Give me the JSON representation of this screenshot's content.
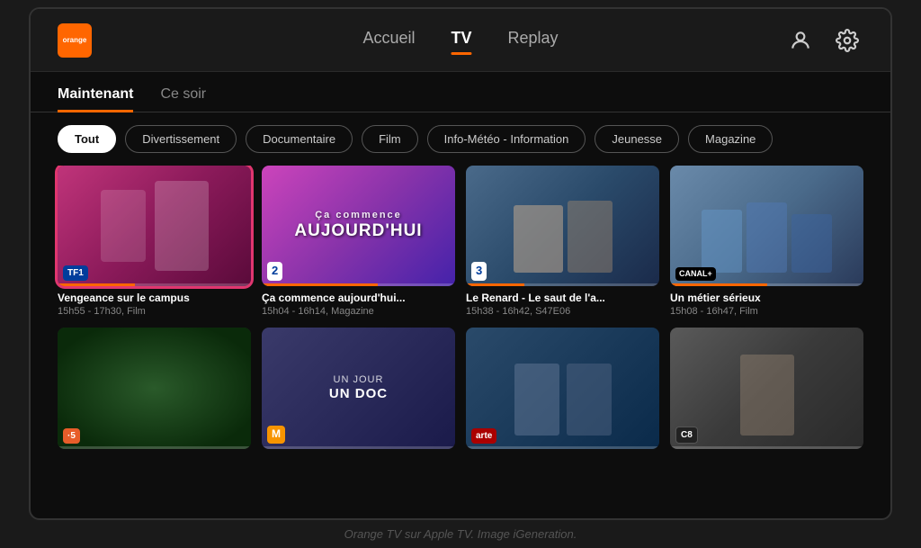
{
  "caption": "Orange TV sur Apple TV. Image iGeneration.",
  "header": {
    "logo": "orange",
    "nav": [
      {
        "label": "Accueil",
        "active": false
      },
      {
        "label": "TV",
        "active": true
      },
      {
        "label": "Replay",
        "active": false
      }
    ],
    "icons": [
      "user",
      "settings"
    ]
  },
  "tabs": [
    {
      "label": "Maintenant",
      "active": true
    },
    {
      "label": "Ce soir",
      "active": false
    }
  ],
  "filters": [
    {
      "label": "Tout",
      "active": true
    },
    {
      "label": "Divertissement",
      "active": false
    },
    {
      "label": "Documentaire",
      "active": false
    },
    {
      "label": "Film",
      "active": false
    },
    {
      "label": "Info-Météo - Information",
      "active": false
    },
    {
      "label": "Jeunesse",
      "active": false
    },
    {
      "label": "Magazine",
      "active": false
    }
  ],
  "cards": [
    {
      "id": 1,
      "title": "Vengeance sur le campus",
      "subtitle": "15h55 - 17h30, Film",
      "channel": "TF1",
      "channel_key": "tf1",
      "thumb_class": "thumb-vengeance",
      "selected": true,
      "progress": 40
    },
    {
      "id": 2,
      "title": "Ça commence aujourd'hui...",
      "subtitle": "15h04 - 16h14, Magazine",
      "channel": "2",
      "channel_key": "france2",
      "thumb_class": "thumb-ca-commence",
      "selected": false,
      "progress": 60,
      "thumb_text": "Ça commence AUJOURD'HUI"
    },
    {
      "id": 3,
      "title": "Le Renard - Le saut de l'a...",
      "subtitle": "15h38 - 16h42, S47E06",
      "channel": "3",
      "channel_key": "france3",
      "thumb_class": "thumb-renard",
      "selected": false,
      "progress": 30
    },
    {
      "id": 4,
      "title": "Un métier sérieux",
      "subtitle": "15h08 - 16h47, Film",
      "channel": "CANAL+",
      "channel_key": "canalplus",
      "thumb_class": "thumb-metier",
      "selected": false,
      "progress": 50
    },
    {
      "id": 5,
      "title": "",
      "subtitle": "",
      "channel": "·5",
      "channel_key": "france5",
      "thumb_class": "thumb-france5",
      "selected": false,
      "progress": 0
    },
    {
      "id": 6,
      "title": "",
      "subtitle": "",
      "channel": "M",
      "channel_key": "m6",
      "thumb_class": "thumb-m6",
      "selected": false,
      "progress": 0,
      "thumb_text": "UN JOUR UN DOC"
    },
    {
      "id": 7,
      "title": "",
      "subtitle": "",
      "channel": "arte",
      "channel_key": "arte",
      "thumb_class": "thumb-arte",
      "selected": false,
      "progress": 0
    },
    {
      "id": 8,
      "title": "",
      "subtitle": "",
      "channel": "C8",
      "channel_key": "c8",
      "thumb_class": "thumb-c8",
      "selected": false,
      "progress": 0
    }
  ]
}
